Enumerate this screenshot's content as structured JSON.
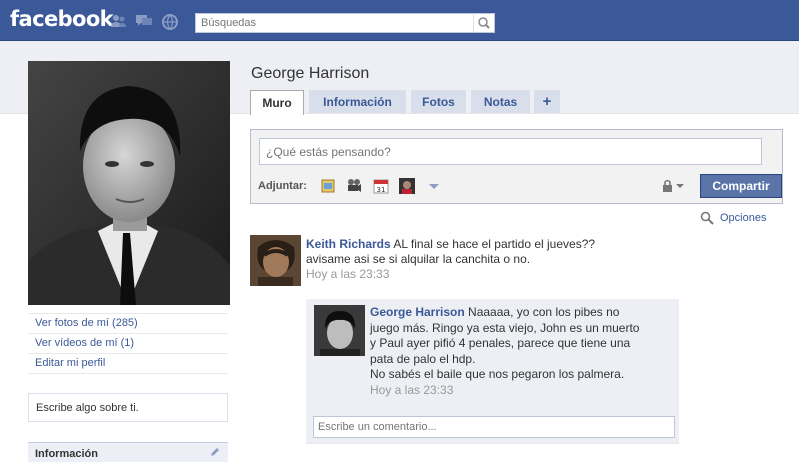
{
  "header": {
    "logo": "facebook",
    "search_placeholder": "Búsquedas",
    "icons": [
      "friend-requests-icon",
      "messages-icon",
      "notifications-icon",
      "search-icon"
    ],
    "colors": {
      "bar": "#3b5998",
      "link": "#3b5998",
      "share_button": "#5b74a8"
    }
  },
  "profile": {
    "name": "George Harrison",
    "links": [
      "Ver fotos de mí (285)",
      "Ver vídeos de mí (1)",
      "Editar mi perfil"
    ],
    "bio_placeholder": "Escribe algo sobre ti.",
    "info_heading": "Información"
  },
  "tabs": [
    {
      "label": "Muro",
      "active": true
    },
    {
      "label": "Información"
    },
    {
      "label": "Fotos"
    },
    {
      "label": "Notas"
    },
    {
      "label": "+"
    }
  ],
  "publisher": {
    "placeholder": "¿Qué estás pensando?",
    "attach_label": "Adjuntar:",
    "attach_icons": [
      "photo-icon",
      "video-icon",
      "event-icon",
      "link-icon",
      "more-attach-icon"
    ],
    "share_label": "Compartir"
  },
  "options_label": "Opciones",
  "story": {
    "author": "Keith Richards",
    "lines": [
      "AL final se hace el partido el jueves??",
      "avisame asi se si alquilar la canchita o no."
    ],
    "timestamp": "Hoy a las 23:33",
    "comment": {
      "author": "George Harrison",
      "lines": [
        "Naaaaa, yo con los pibes no",
        "juego más. Ringo ya esta viejo, John es un muerto",
        "y Paul ayer pifió 4 penales, parece que tiene una",
        "pata de palo el hdp.",
        "No sabés el baile que nos pegaron los palmera."
      ],
      "timestamp": "Hoy a las 23:33"
    },
    "comment_placeholder": "Escribe un comentario..."
  }
}
